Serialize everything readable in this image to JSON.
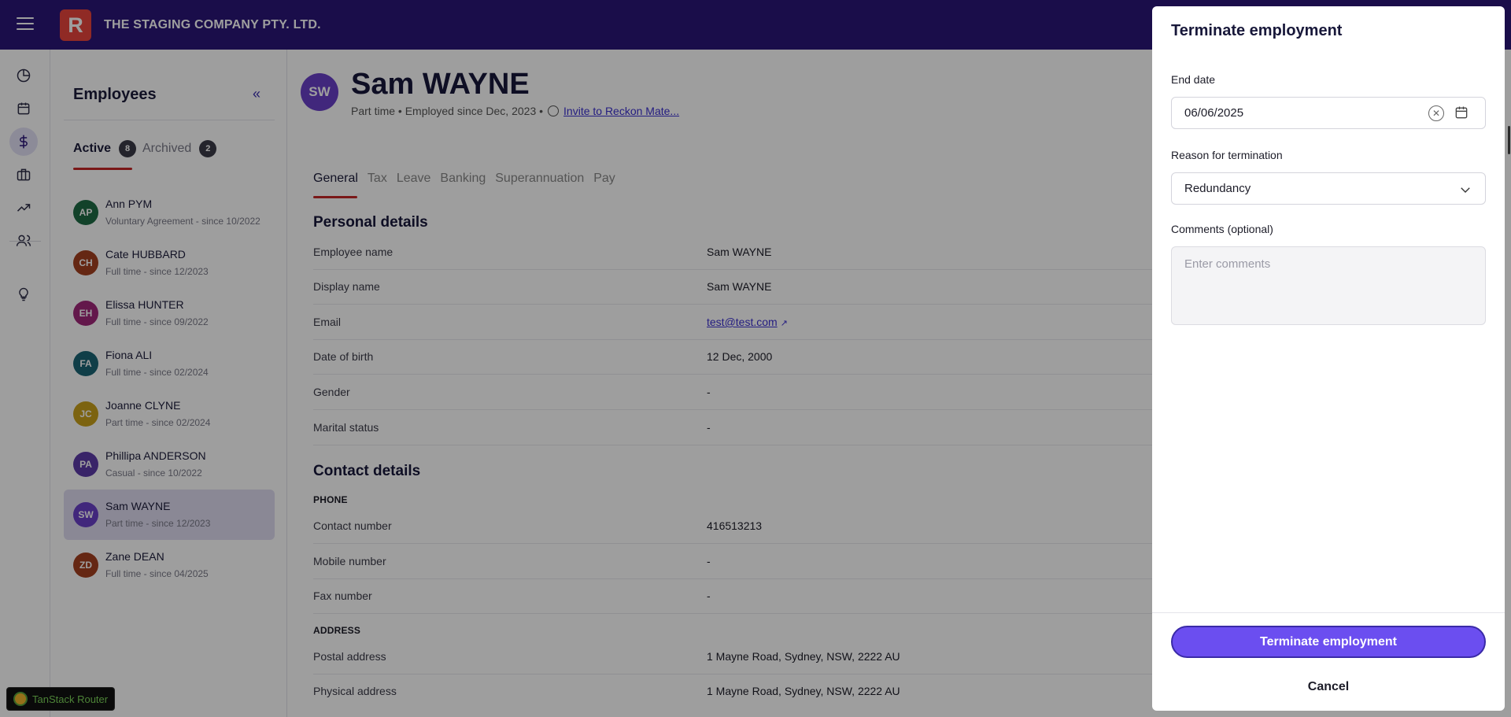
{
  "topbar": {
    "logo_letter": "R",
    "company": "THE STAGING COMPANY PTY. LTD."
  },
  "rail": {
    "items": [
      "dashboard-icon",
      "calendar-icon",
      "dollar-icon",
      "briefcase-icon",
      "trending-icon",
      "people-icon",
      "lightbulb-icon"
    ]
  },
  "employees": {
    "title": "Employees",
    "tabs": {
      "active_label": "Active",
      "active_count": "8",
      "archived_label": "Archived",
      "archived_count": "2"
    },
    "list": [
      {
        "initials": "AP",
        "name": "Ann PYM",
        "sub": "Voluntary Agreement - since 10/2022",
        "color": "#1e6b45"
      },
      {
        "initials": "CH",
        "name": "Cate HUBBARD",
        "sub": "Full time - since 12/2023",
        "color": "#a3401f"
      },
      {
        "initials": "EH",
        "name": "Elissa HUNTER",
        "sub": "Full time - since 09/2022",
        "color": "#a1287a"
      },
      {
        "initials": "FA",
        "name": "Fiona ALI",
        "sub": "Full time - since 02/2024",
        "color": "#1a6475"
      },
      {
        "initials": "JC",
        "name": "Joanne CLYNE",
        "sub": "Part time - since 02/2024",
        "color": "#c9a11a"
      },
      {
        "initials": "PA",
        "name": "Phillipa ANDERSON",
        "sub": "Casual - since 10/2022",
        "color": "#5c3ba8"
      },
      {
        "initials": "SW",
        "name": "Sam WAYNE",
        "sub": "Part time - since 12/2023",
        "color": "#6a3fc8"
      },
      {
        "initials": "ZD",
        "name": "Zane DEAN",
        "sub": "Full time - since 04/2025",
        "color": "#a3401f"
      }
    ]
  },
  "devtools": {
    "label": "TanStack Router"
  },
  "profile": {
    "initials": "SW",
    "name": "Sam WAYNE",
    "subtitle": "Part time • Employed since Dec, 2023 •",
    "invite_link": "Invite to Reckon Mate..."
  },
  "tabs": [
    "General",
    "Tax",
    "Leave",
    "Banking",
    "Superannuation",
    "Pay"
  ],
  "personal": {
    "heading": "Personal details",
    "rows": [
      {
        "label": "Employee name",
        "value": "Sam WAYNE"
      },
      {
        "label": "Display name",
        "value": "Sam WAYNE"
      },
      {
        "label": "Email",
        "value": "test@test.com"
      },
      {
        "label": "Date of birth",
        "value": "12 Dec, 2000"
      },
      {
        "label": "Gender",
        "value": "-"
      },
      {
        "label": "Marital status",
        "value": "-"
      }
    ]
  },
  "contact": {
    "heading": "Contact details",
    "phone_group": "PHONE",
    "phone_rows": [
      {
        "label": "Contact number",
        "value": "416513213"
      },
      {
        "label": "Mobile number",
        "value": "-"
      },
      {
        "label": "Fax number",
        "value": "-"
      }
    ],
    "address_group": "ADDRESS",
    "address_rows": [
      {
        "label": "Postal address",
        "value": "1 Mayne Road, Sydney, NSW, 2222 AU"
      },
      {
        "label": "Physical address",
        "value": "1 Mayne Road, Sydney, NSW, 2222 AU"
      }
    ]
  },
  "drawer": {
    "title": "Terminate employment",
    "end_date_label": "End date",
    "end_date_value": "06/06/2025",
    "reason_label": "Reason for termination",
    "reason_value": "Redundancy",
    "comments_label": "Comments (optional)",
    "comments_placeholder": "Enter comments",
    "submit_label": "Terminate employment",
    "cancel_label": "Cancel"
  },
  "colors": {
    "brand": "#2a1578",
    "accent": "#6b4ef0",
    "tab_underline": "#c62828"
  }
}
